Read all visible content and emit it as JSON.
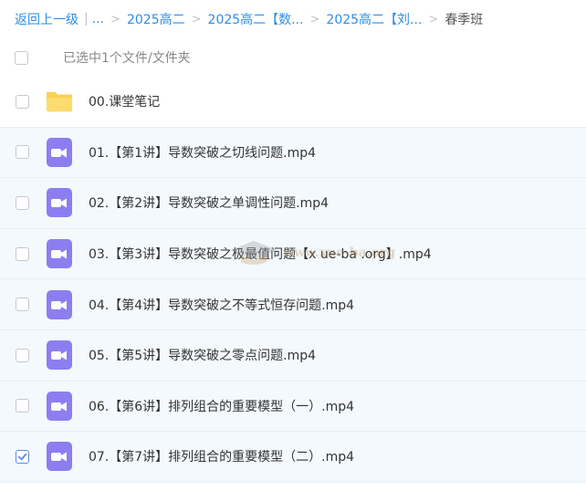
{
  "breadcrumb": {
    "back": "返回上一级",
    "ellipsis": "...",
    "items": [
      "2025高二",
      "2025高二【数...",
      "2025高二【刘..."
    ],
    "current": "春季班"
  },
  "selection": {
    "status": "已选中1个文件/文件夹"
  },
  "files": [
    {
      "name": "00.课堂笔记",
      "type": "folder",
      "checked": false,
      "icon": "folder-icon"
    },
    {
      "name": "01.【第1讲】导数突破之切线问题.mp4",
      "type": "video",
      "checked": false,
      "icon": "video-icon"
    },
    {
      "name": "02.【第2讲】导数突破之单调性问题.mp4",
      "type": "video",
      "checked": false,
      "icon": "video-icon"
    },
    {
      "name": "03.【第3讲】导数突破之极最值问题【x ue-ba .org】.mp4",
      "type": "video",
      "checked": false,
      "icon": "video-icon"
    },
    {
      "name": "04.【第4讲】导数突破之不等式恒存问题.mp4",
      "type": "video",
      "checked": false,
      "icon": "video-icon"
    },
    {
      "name": "05.【第5讲】导数突破之零点问题.mp4",
      "type": "video",
      "checked": false,
      "icon": "video-icon"
    },
    {
      "name": "06.【第6讲】排列组合的重要模型（一）.mp4",
      "type": "video",
      "checked": false,
      "icon": "video-icon"
    },
    {
      "name": "07.【第7讲】排列组合的重要模型（二）.mp4",
      "type": "video",
      "checked": true,
      "icon": "video-icon"
    }
  ],
  "watermark": {
    "text": "www.xue-ba.org"
  },
  "colors": {
    "link": "#2e8ee6",
    "folder": "#fbd154",
    "video": "#8c7ef0",
    "row_tint": "#f3f9fd",
    "check": "#5b8fe8"
  }
}
